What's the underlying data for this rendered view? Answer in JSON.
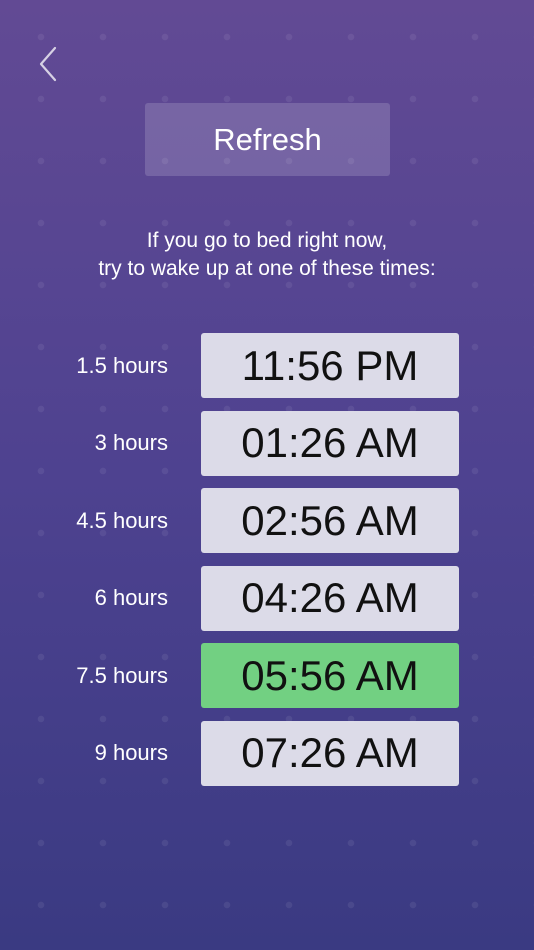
{
  "header": {
    "back_icon": "chevron-left-icon",
    "refresh_label": "Refresh"
  },
  "intro": {
    "line1": "If you go to bed right now,",
    "line2": "try to wake up at one of these times:"
  },
  "options": [
    {
      "duration": "1.5 hours",
      "time": "11:56 PM",
      "recommended": false
    },
    {
      "duration": "3 hours",
      "time": "01:26 AM",
      "recommended": false
    },
    {
      "duration": "4.5 hours",
      "time": "02:56 AM",
      "recommended": false
    },
    {
      "duration": "6 hours",
      "time": "04:26 AM",
      "recommended": false
    },
    {
      "duration": "7.5 hours",
      "time": "05:56 AM",
      "recommended": true
    },
    {
      "duration": "9 hours",
      "time": "07:26 AM",
      "recommended": false
    }
  ],
  "colors": {
    "background_top": "#624a94",
    "background_bottom": "#3a3a82",
    "time_button": "#dcdbe8",
    "recommended": "#72d082"
  }
}
